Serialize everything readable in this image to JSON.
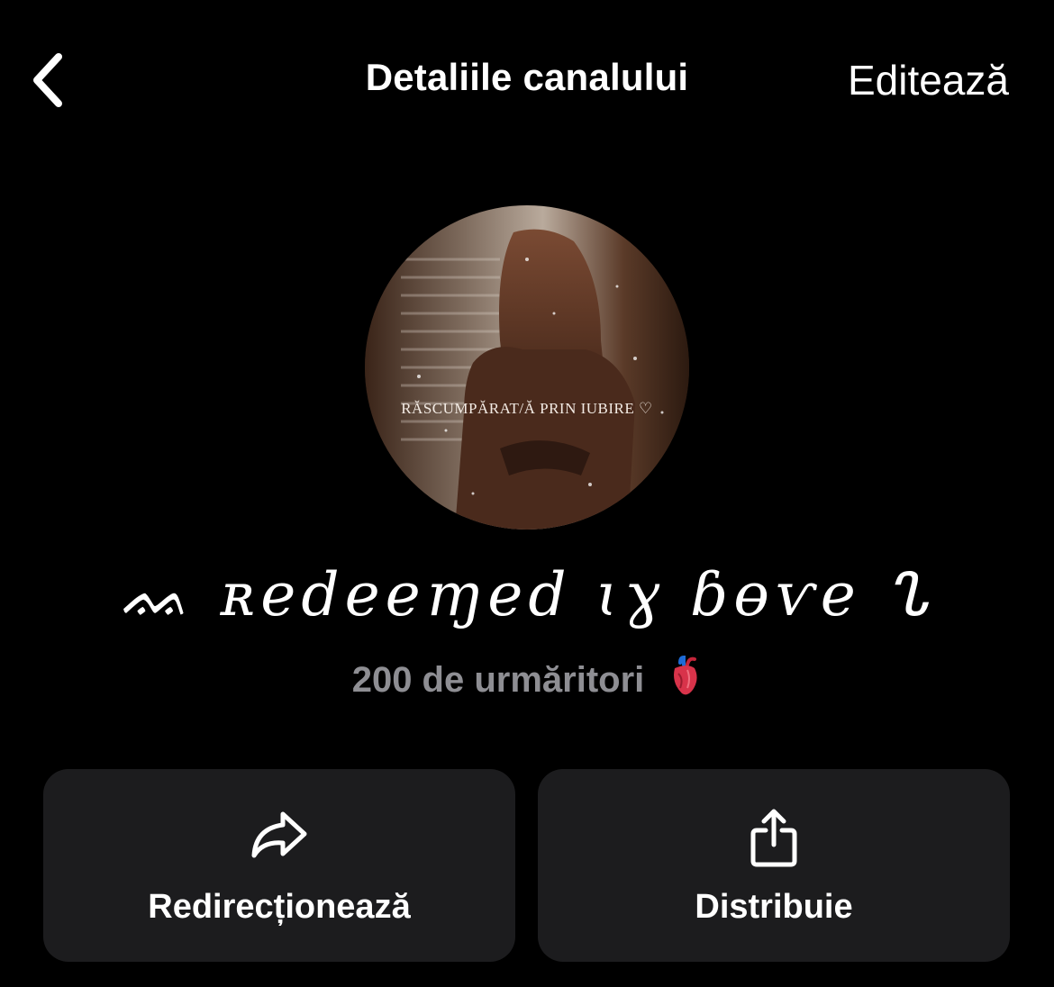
{
  "header": {
    "back_icon": "chevron-left-icon",
    "title": "Detaliile canalului",
    "edit_label": "Editează"
  },
  "channel": {
    "avatar_caption": "RĂSCUMPĂRAT/Ă PRIN IUBIRE ♡",
    "name": "ᨐ ʀedeeɱed ɩɣ ɓɵѵe ᔐ",
    "followers_text": "200 de urmăritori",
    "followers_emoji_icon": "anatomical-heart-icon"
  },
  "actions": [
    {
      "label": "Redirecționează",
      "icon": "forward-arrow-icon"
    },
    {
      "label": "Distribuie",
      "icon": "share-icon"
    }
  ],
  "colors": {
    "background": "#000000",
    "button_bg": "#1c1c1e",
    "text_primary": "#ffffff",
    "text_secondary": "#8e8e93"
  }
}
